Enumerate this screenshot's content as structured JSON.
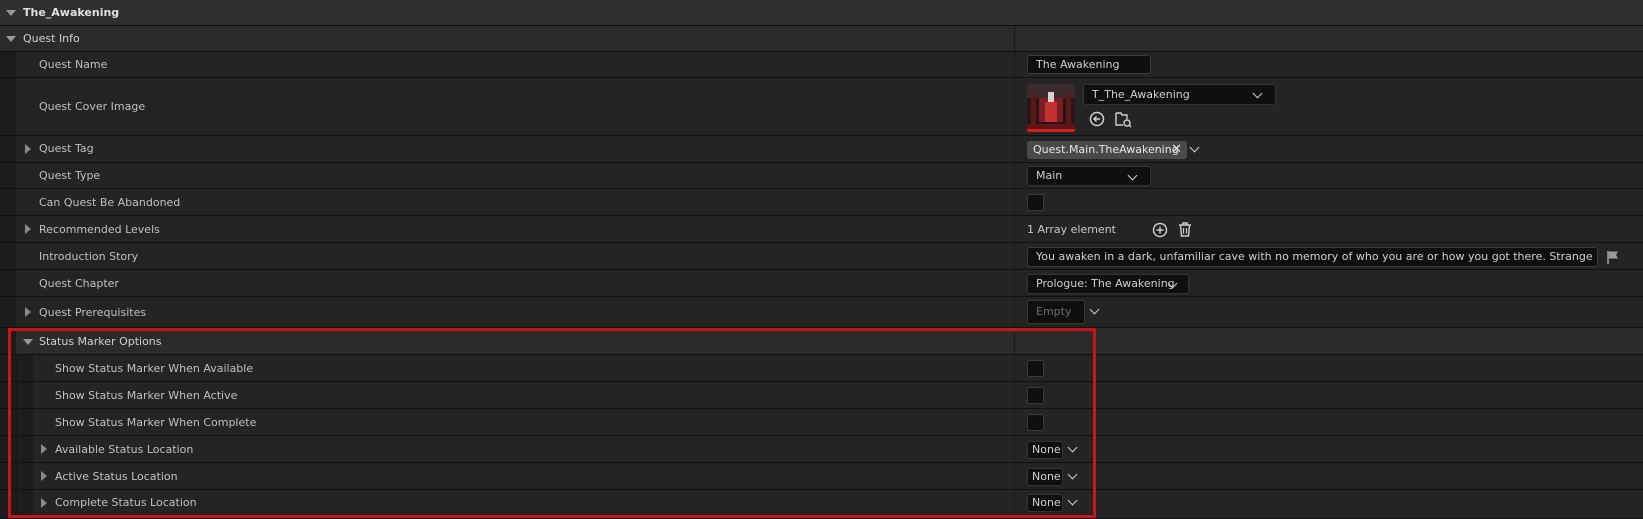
{
  "header": {
    "title": "The_Awakening"
  },
  "quest_info": {
    "label": "Quest Info",
    "quest_name": {
      "label": "Quest Name",
      "value": "The Awakening"
    },
    "quest_cover_image": {
      "label": "Quest Cover Image",
      "asset": "T_The_Awakening"
    },
    "quest_tag": {
      "label": "Quest Tag",
      "value": "Quest.Main.TheAwakening"
    },
    "quest_type": {
      "label": "Quest Type",
      "value": "Main"
    },
    "can_abandon": {
      "label": "Can Quest Be Abandoned",
      "checked": false
    },
    "recommended_levels": {
      "label": "Recommended Levels",
      "value": "1 Array element"
    },
    "introduction_story": {
      "label": "Introduction Story",
      "value": "You awaken in a dark, unfamiliar cave with no memory of who you are or how you got there. Strange markings c"
    },
    "quest_chapter": {
      "label": "Quest Chapter",
      "value": "Prologue: The Awakening"
    },
    "quest_prerequisites": {
      "label": "Quest Prerequisites",
      "value": "Empty"
    }
  },
  "status_marker_options": {
    "label": "Status Marker Options",
    "show_available": {
      "label": "Show Status Marker When Available",
      "checked": false
    },
    "show_active": {
      "label": "Show Status Marker When Active",
      "checked": false
    },
    "show_complete": {
      "label": "Show Status Marker When Complete",
      "checked": false
    },
    "available_location": {
      "label": "Available Status Location",
      "value": "None"
    },
    "active_location": {
      "label": "Active Status Location",
      "value": "None"
    },
    "complete_location": {
      "label": "Complete Status Location",
      "value": "None"
    }
  },
  "colors": {
    "highlight": "#c4161c",
    "panel": "#242424",
    "field": "#0f0f0f"
  }
}
